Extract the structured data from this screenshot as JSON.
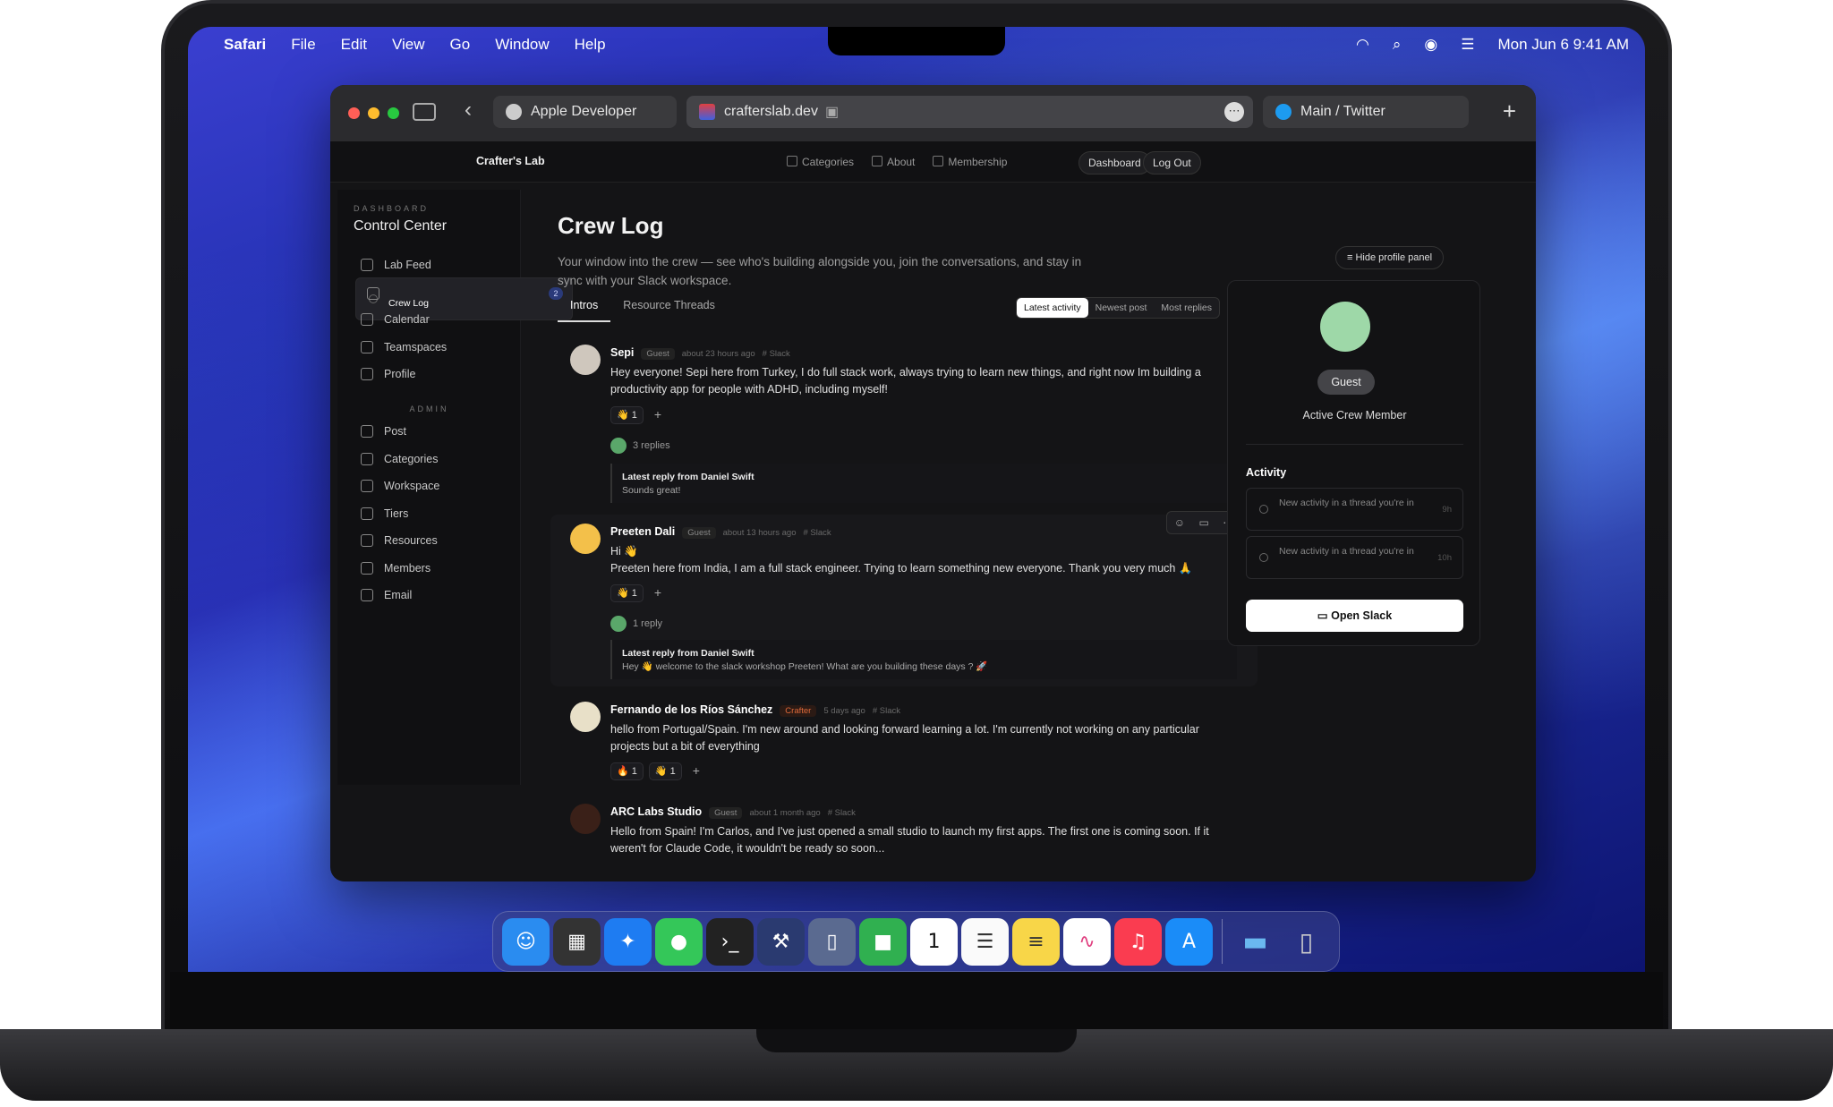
{
  "menubar": {
    "app": "Safari",
    "items": [
      "File",
      "Edit",
      "View",
      "Go",
      "Window",
      "Help"
    ],
    "datetime": "Mon Jun 6  9:41 AM"
  },
  "browser": {
    "tabs": [
      "Apple Developer",
      "crafterslab.dev",
      "Main / Twitter"
    ],
    "new_tab": "+"
  },
  "site": {
    "brand": "Crafter's Lab",
    "nav": [
      "Categories",
      "About",
      "Membership"
    ],
    "dashboard": "Dashboard",
    "logout": "Log Out"
  },
  "sidebar": {
    "caption": "DASHBOARD",
    "title": "Control Center",
    "items": [
      {
        "label": "Lab Feed"
      },
      {
        "label": "Crew Log",
        "badge": "2"
      },
      {
        "label": "Calendar"
      },
      {
        "label": "Teamspaces"
      },
      {
        "label": "Profile"
      }
    ],
    "admin_caption": "ADMIN",
    "admin_items": [
      "Post",
      "Categories",
      "Workspace",
      "Tiers",
      "Resources",
      "Members",
      "Email"
    ]
  },
  "main": {
    "title": "Crew Log",
    "description": "Your window into the crew — see who's building alongside you, join the conversations, and stay in sync with your Slack workspace.",
    "tabs": [
      "Intros",
      "Resource Threads"
    ],
    "sort": [
      "Latest activity",
      "Newest post",
      "Most replies"
    ],
    "hide_panel": "Hide profile panel"
  },
  "posts": [
    {
      "name": "Sepi",
      "role": "Guest",
      "time": "about 23 hours ago",
      "source": "# Slack",
      "text": "Hey everyone! Sepi here from Turkey, I do full stack work, always trying to learn new things, and right now Im building a productivity app for people with ADHD, including myself!",
      "reactions": [
        "👋 1"
      ],
      "replies": "3 replies",
      "latest_from": "Latest reply from Daniel Swift",
      "latest_text": "Sounds great!"
    },
    {
      "name": "Preeten Dali",
      "role": "Guest",
      "time": "about 13 hours ago",
      "source": "# Slack",
      "text": "Hi 👋\nPreeten here from India, I am a full stack engineer. Trying to learn something new everyone. Thank you very much 🙏",
      "reactions": [
        "👋 1"
      ],
      "replies": "1 reply",
      "latest_from": "Latest reply from Daniel Swift",
      "latest_text": "Hey 👋 welcome to the slack workshop Preeten! What are you building these days ? 🚀"
    },
    {
      "name": "Fernando de los Ríos Sánchez",
      "role": "Crafter",
      "time": "5 days ago",
      "source": "# Slack",
      "text": "hello from Portugal/Spain. I'm new around and looking forward learning a lot. I'm currently not working on any particular projects but a bit of everything",
      "reactions": [
        "🔥 1",
        "👋 1"
      ]
    },
    {
      "name": "ARC Labs Studio",
      "role": "Guest",
      "time": "about 1 month ago",
      "source": "# Slack",
      "text": "Hello from Spain! I'm Carlos, and I've just opened a small studio to launch my first apps. The first one is coming soon. If it weren't for Claude Code, it wouldn't be ready so soon..."
    }
  ],
  "profile": {
    "badge": "Guest",
    "subtitle": "Active Crew Member",
    "activity_title": "Activity",
    "activity": [
      {
        "text": "New activity in a thread you're in",
        "time": "9h"
      },
      {
        "text": "New activity in a thread you're in",
        "time": "10h"
      }
    ],
    "open_slack": "Open Slack"
  }
}
